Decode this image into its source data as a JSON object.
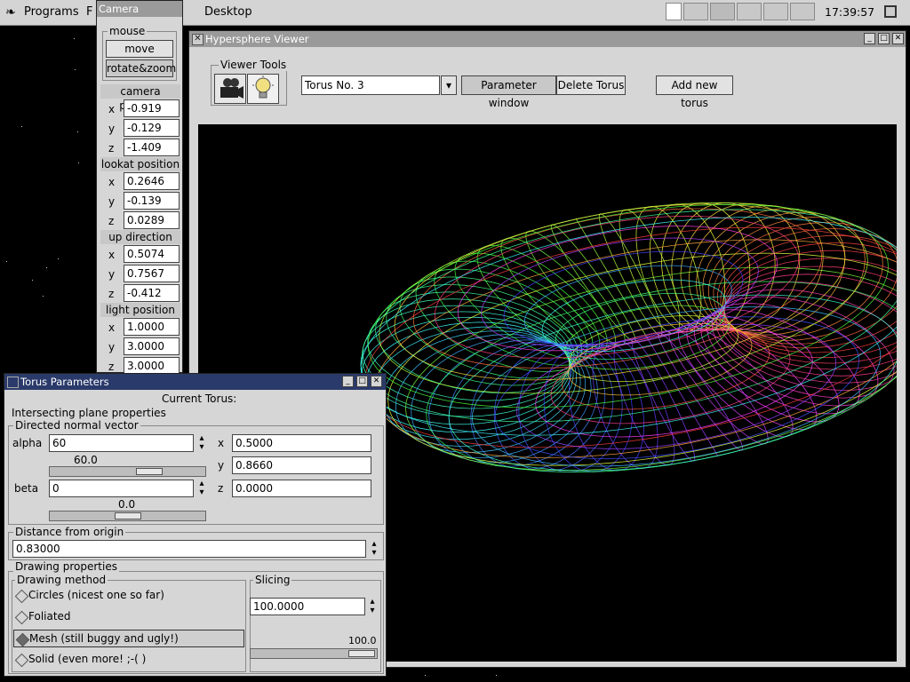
{
  "panel": {
    "programs": "Programs",
    "f_label": "F",
    "desktop": "Desktop",
    "clock": "17:39:57"
  },
  "camera": {
    "title": "Camera",
    "mouse_label": "mouse",
    "move": "move",
    "rotate_zoom": "rotate&zoom",
    "camera_position": "camera position",
    "lookat_position": "lookat position",
    "up_direction": "up direction",
    "light_position": "light position",
    "x": "x",
    "y": "y",
    "z": "z",
    "cam": {
      "x": "-0.919",
      "y": "-0.129",
      "z": "-1.409"
    },
    "lookat": {
      "x": "0.2646",
      "y": "-0.139",
      "z": "0.0289"
    },
    "up": {
      "x": "0.5074",
      "y": "0.7567",
      "z": "-0.412"
    },
    "light": {
      "x": "1.0000",
      "y": "3.0000",
      "z": "3.0000"
    }
  },
  "viewer": {
    "title": "Hypersphere Viewer",
    "tools_label": "Viewer Tools",
    "torus_select": "Torus No. 3",
    "param_window": "Parameter window",
    "delete_torus": "Delete Torus",
    "add_torus": "Add new torus"
  },
  "torus": {
    "title": "Torus Parameters",
    "current": "Current Torus:",
    "intersecting": "Intersecting plane properties",
    "directed": "Directed normal vector",
    "alpha_label": "alpha",
    "alpha_value": "60",
    "alpha_slider_text": "60.0",
    "alpha_level": 60,
    "beta_label": "beta",
    "beta_value": "0",
    "beta_slider_text": "0.0",
    "beta_level": 0,
    "x_label": "x",
    "y_label": "y",
    "z_label": "z",
    "vx": "0.5000",
    "vy": "0.8660",
    "vz": "0.0000",
    "distance_label": "Distance from origin",
    "distance_value": "0.83000",
    "drawing_props": "Drawing properties",
    "drawing_method": "Drawing method",
    "methods": [
      "Circles (nicest one so far)",
      "Foliated",
      "Mesh (still buggy and ugly!)",
      "Solid (even more! ;-(  )"
    ],
    "selected_method": 2,
    "slicing_label": "Slicing",
    "slicing_value": "100.0000",
    "slicing_slider_text": "100.0"
  },
  "colors": {
    "titlebar_active": "#2a3a6a",
    "window_bg": "#d6d6d6",
    "canvas_bg": "#000000"
  }
}
